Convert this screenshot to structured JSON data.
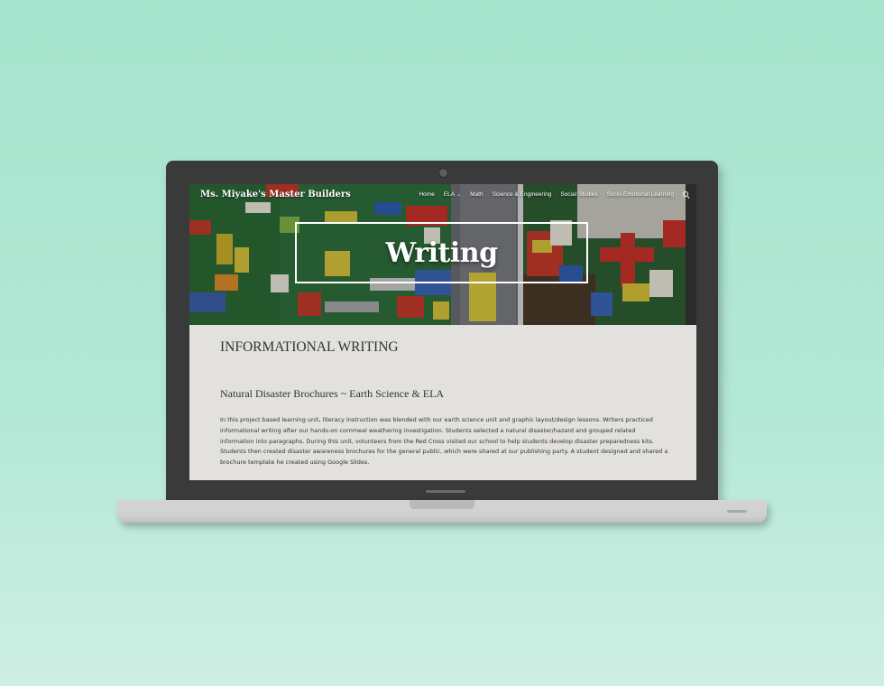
{
  "header": {
    "site_title": "Ms. Miyake's Master Builders",
    "nav": [
      {
        "label": "Home"
      },
      {
        "label": "ELA",
        "has_dropdown": true,
        "active": true
      },
      {
        "label": "Math"
      },
      {
        "label": "Science & Engineering"
      },
      {
        "label": "Social Studies"
      },
      {
        "label": "Socio-Emotional Learning"
      }
    ],
    "search_icon": "search-icon"
  },
  "hero": {
    "title": "Writing"
  },
  "main": {
    "section_heading": "INFORMATIONAL WRITING",
    "sub_heading": "Natural Disaster Brochures ~ Earth Science & ELA",
    "paragraph_lines": [
      "In this project based learning unit, literacy instruction was blended with our earth science unit and graphic layout/design lessons.  Writers practiced",
      "informational writing after our hands-on cornmeal weathering investigation.  Students selected a natural disaster/hazard and grouped related",
      "information into paragraphs.  During this unit, volunteers from the Red Cross visited our school to help students develop disaster preparedness kits.",
      "Students then created disaster awareness brochures for the general public, which were shared at our publishing party.  A student designed and shared a",
      "brochure template he created using Google Slides."
    ]
  },
  "colors": {
    "background": "#a5e3cd",
    "laptop_frame": "#3a3a3a",
    "page_background": "#e2e1dd",
    "text": "#333333"
  }
}
